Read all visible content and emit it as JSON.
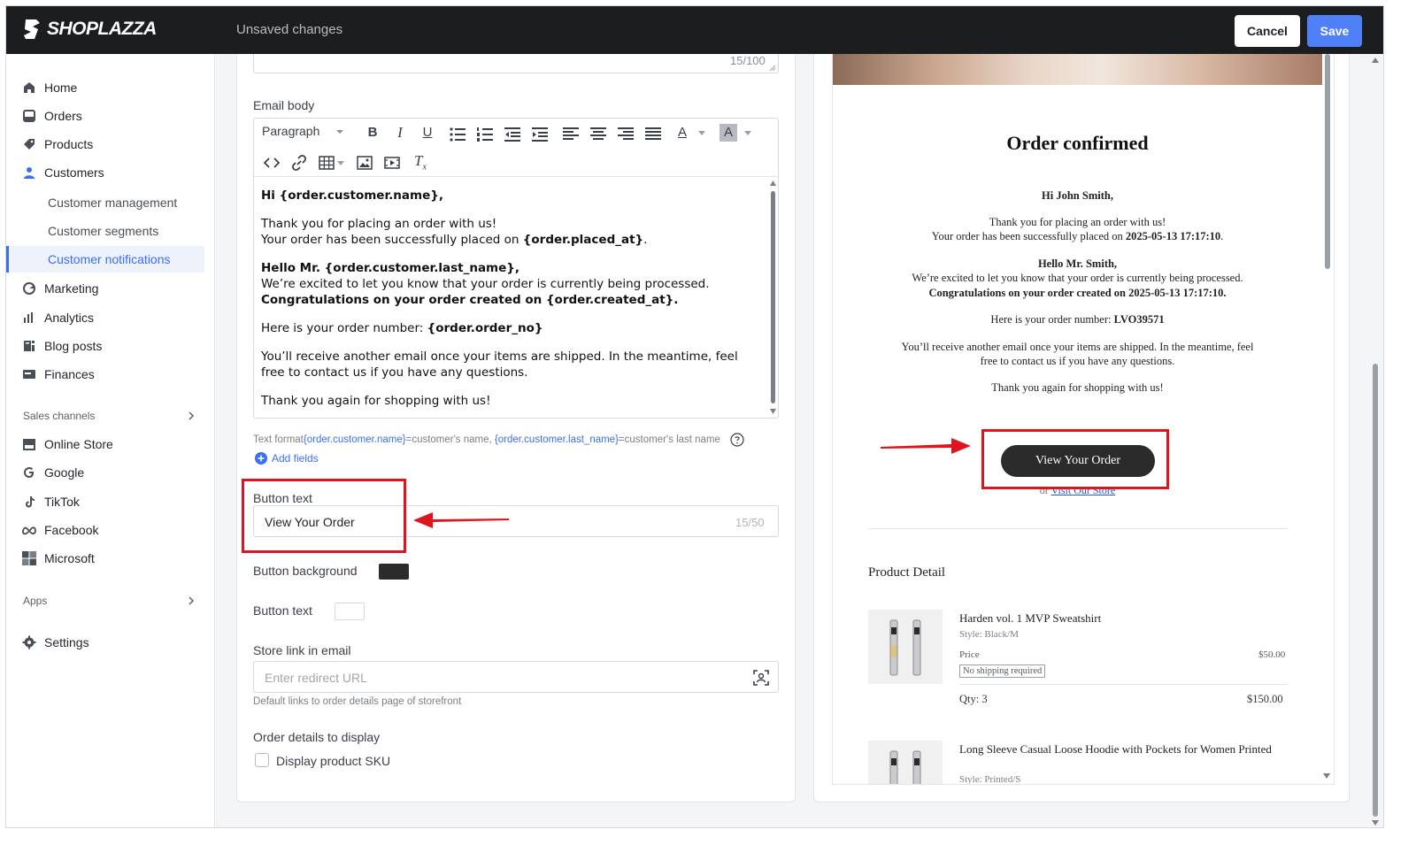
{
  "topbar": {
    "brand": "SHOPLAZZA",
    "status": "Unsaved changes",
    "cancel_label": "Cancel",
    "save_label": "Save"
  },
  "sidebar": {
    "items": [
      {
        "label": "Home",
        "icon": "home-icon"
      },
      {
        "label": "Orders",
        "icon": "orders-icon"
      },
      {
        "label": "Products",
        "icon": "tag-icon"
      },
      {
        "label": "Customers",
        "icon": "person-icon"
      },
      {
        "label": "Marketing",
        "icon": "marketing-icon"
      },
      {
        "label": "Analytics",
        "icon": "bar-chart-icon"
      },
      {
        "label": "Blog posts",
        "icon": "blog-icon"
      },
      {
        "label": "Finances",
        "icon": "finances-icon"
      }
    ],
    "customer_sub": [
      {
        "label": "Customer management"
      },
      {
        "label": "Customer segments"
      },
      {
        "label": "Customer notifications"
      }
    ],
    "sales_channels_label": "Sales channels",
    "channels": [
      {
        "label": "Online Store",
        "icon": "store-icon"
      },
      {
        "label": "Google",
        "icon": "google-icon"
      },
      {
        "label": "TikTok",
        "icon": "tiktok-icon"
      },
      {
        "label": "Facebook",
        "icon": "meta-icon"
      },
      {
        "label": "Microsoft",
        "icon": "microsoft-icon"
      }
    ],
    "apps_label": "Apps",
    "settings_label": "Settings",
    "active_color": "#3b6ef5"
  },
  "editor": {
    "subject_counter": "15/100",
    "email_body_label": "Email body",
    "paragraph_select": "Paragraph",
    "body": {
      "greeting": "Hi {order.customer.name},",
      "thanks": "Thank you for placing an order with us!",
      "placed_prefix": "Your order has been successfully placed on ",
      "placed_var": "{order.placed_at}",
      "placed_suffix": ".",
      "hello": "Hello Mr. {order.customer.last_name},",
      "processing": "We’re excited to let you know that your order is currently being processed.",
      "congrats": "Congratulations on your order created on {order.created_at}.",
      "number_prefix": "Here is your order number: ",
      "number_var": "{order.order_no}",
      "receive": "You’ll receive another email once your items are shipped. In the meantime, feel free to contact us if you have any questions.",
      "thanks_again": "Thank you again for shopping with us!"
    },
    "hint_prefix": "Text format",
    "hint_var1": "{order.customer.name}",
    "hint_mid": "=customer's name, ",
    "hint_var2": "{order.customer.last_name}",
    "hint_suffix": "=customer's last name",
    "add_fields_label": "Add fields",
    "button_text_label": "Button text",
    "button_text_value": "View Your Order",
    "button_text_counter": "15/50",
    "button_background_label": "Button background",
    "button_background_color": "#2b2b2b",
    "button_text_color_label": "Button text",
    "button_text_color": "#ffffff",
    "store_link_label": "Store link in email",
    "store_link_placeholder": "Enter redirect URL",
    "store_link_note": "Default links to order details page of storefront",
    "order_details_label": "Order details to display",
    "display_sku_label": "Display product SKU"
  },
  "preview": {
    "title": "Order confirmed",
    "greeting": "Hi John Smith,",
    "thanks": "Thank you for placing an order with us!",
    "placed_prefix": "Your order has been successfully placed on ",
    "placed_date": "2025-05-13 17:17:10",
    "placed_suffix": ".",
    "hello": "Hello Mr. Smith,",
    "processing": "We’re excited to let you know that your order is currently being processed.",
    "congrats": "Congratulations on your order created on 2025-05-13 17:17:10.",
    "number_prefix": "Here is your order number: ",
    "number": "LVO39571",
    "receive_line1": "You’ll receive another email once your items are shipped. In the meantime, feel",
    "receive_line2": "free to contact us if you have any questions.",
    "thanks_again": "Thank you again for shopping with us!",
    "button_label": "View Your Order",
    "or_label": "or ",
    "visit_store_label": "Visit Our Store",
    "product_section": "Product Detail",
    "products": [
      {
        "name": "Harden vol. 1 MVP Sweatshirt",
        "style": "Style: Black/M",
        "price_label": "Price",
        "price": "$50.00",
        "shipping_badge": "No shipping required",
        "qty": "Qty: 3",
        "total": "$150.00"
      },
      {
        "name": "Long Sleeve Casual Loose Hoodie with Pockets for Women Printed",
        "style": "Style: Printed/S"
      }
    ]
  },
  "annotation_color": "#e0141e"
}
